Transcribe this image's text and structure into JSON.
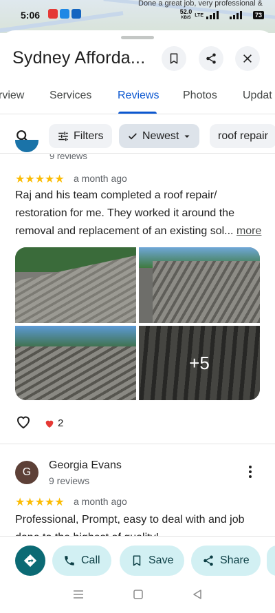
{
  "status_bar": {
    "time": "5:06",
    "network_speed": "52.0",
    "speed_unit": "KB/S",
    "network_type": "LTE",
    "battery": "73",
    "background_snippet": "Done a great job, very professional &"
  },
  "place": {
    "title": "Sydney Afforda...",
    "save_icon": "bookmark-icon",
    "share_icon": "share-icon",
    "close_icon": "close-icon"
  },
  "tabs": [
    {
      "label": "rview"
    },
    {
      "label": "Services"
    },
    {
      "label": "Reviews"
    },
    {
      "label": "Photos"
    },
    {
      "label": "Updat"
    }
  ],
  "filters": {
    "filters_label": "Filters",
    "sort_label": "Newest",
    "keyword_chip": "roof repair"
  },
  "review1": {
    "prev_reviews_count": "9 reviews",
    "rating": 5,
    "stars": "★★★★★",
    "time_ago": "a month ago",
    "text": "Raj and his team completed a roof repair/ restoration for me. They worked it around the removal and replacement of an existing sol...",
    "more_label": "more",
    "extra_photos": "+5",
    "likes": "2"
  },
  "review2": {
    "avatar_letter": "G",
    "author": "Georgia Evans",
    "reviews_count": "9 reviews",
    "rating": 5,
    "stars": "★★★★★",
    "time_ago": "a month ago",
    "text": "Professional, Prompt, easy to deal with and job done to the highest of quality!"
  },
  "actions": {
    "call_label": "Call",
    "save_label": "Save",
    "share_label": "Share"
  },
  "colors": {
    "accent": "#0b57d0",
    "star": "#fbbc04",
    "directions": "#0b6a74",
    "pill_bg": "#d2f0f3"
  }
}
